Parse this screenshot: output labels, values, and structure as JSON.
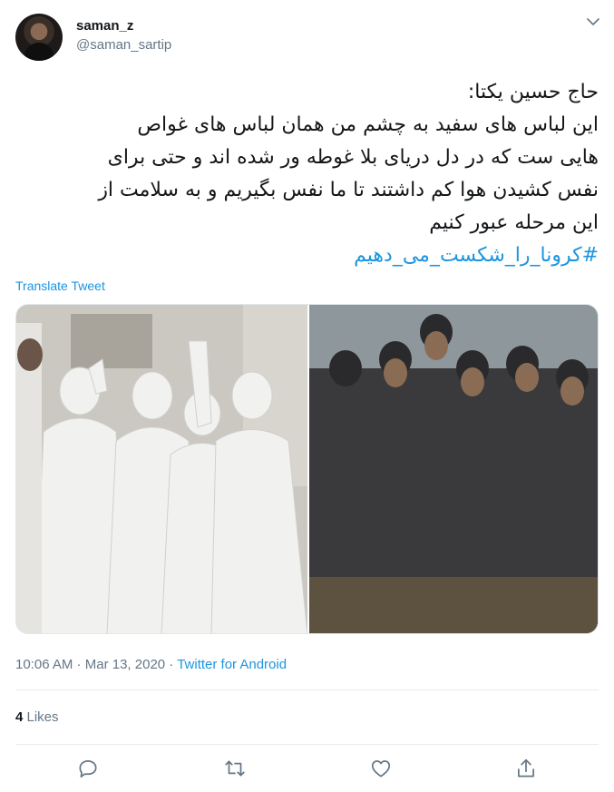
{
  "user": {
    "display_name": "saman_z",
    "handle": "@saman_sartip"
  },
  "tweet": {
    "lines": [
      "حاج حسین یکتا:",
      "این لباس های سفید به چشم من همان لباس های غواص",
      "هایی ست که در دل دریای بلا غوطه ور شده اند و حتی برای",
      "نفس کشیدن هوا کم داشتند تا ما نفس بگیریم و به سلامت از",
      "این مرحله عبور کنیم"
    ],
    "hashtag": "#کرونا_را_شکست_می_دهیم"
  },
  "translate_label": "Translate Tweet",
  "meta": {
    "time": "10:06 AM",
    "separator1": " · ",
    "date": "Mar 13, 2020",
    "separator2": " · ",
    "source": "Twitter for Android"
  },
  "likes": {
    "count": "4",
    "label": " Likes"
  },
  "icons": {
    "more": "chevron-down-icon",
    "reply": "reply-icon",
    "retweet": "retweet-icon",
    "like": "heart-icon",
    "share": "share-icon"
  },
  "colors": {
    "accent": "#1b95e0",
    "muted": "#657786",
    "text": "#14171a",
    "border": "#e6ecf0"
  }
}
